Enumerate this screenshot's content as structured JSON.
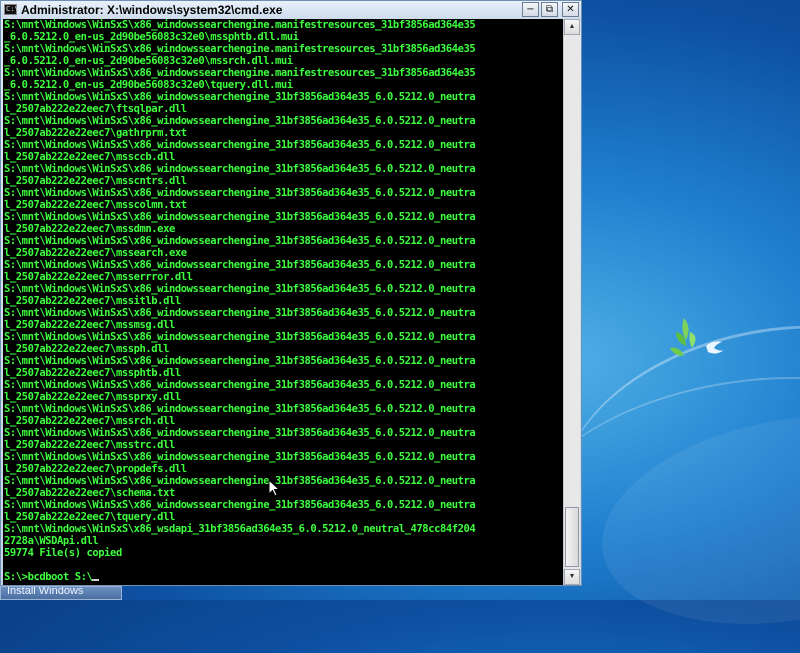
{
  "window": {
    "title": "Administrator: X:\\windows\\system32\\cmd.exe",
    "icon_label": "C:\\",
    "controls": {
      "minimize": "−",
      "maximize": "⧉",
      "close": "✕"
    }
  },
  "console": {
    "lines": [
      "S:\\mnt\\Windows\\WinSxS\\x86_windowssearchengine.manifestresources_31bf3856ad364e35",
      "_6.0.5212.0_en-us_2d90be56083c32e0\\mssphtb.dll.mui",
      "S:\\mnt\\Windows\\WinSxS\\x86_windowssearchengine.manifestresources_31bf3856ad364e35",
      "_6.0.5212.0_en-us_2d90be56083c32e0\\mssrch.dll.mui",
      "S:\\mnt\\Windows\\WinSxS\\x86_windowssearchengine.manifestresources_31bf3856ad364e35",
      "_6.0.5212.0_en-us_2d90be56083c32e0\\tquery.dll.mui",
      "S:\\mnt\\Windows\\WinSxS\\x86_windowssearchengine_31bf3856ad364e35_6.0.5212.0_neutra",
      "l_2507ab222e22eec7\\ftsqlpar.dll",
      "S:\\mnt\\Windows\\WinSxS\\x86_windowssearchengine_31bf3856ad364e35_6.0.5212.0_neutra",
      "l_2507ab222e22eec7\\gathrprm.txt",
      "S:\\mnt\\Windows\\WinSxS\\x86_windowssearchengine_31bf3856ad364e35_6.0.5212.0_neutra",
      "l_2507ab222e22eec7\\mssccb.dll",
      "S:\\mnt\\Windows\\WinSxS\\x86_windowssearchengine_31bf3856ad364e35_6.0.5212.0_neutra",
      "l_2507ab222e22eec7\\msscntrs.dll",
      "S:\\mnt\\Windows\\WinSxS\\x86_windowssearchengine_31bf3856ad364e35_6.0.5212.0_neutra",
      "l_2507ab222e22eec7\\msscolmn.txt",
      "S:\\mnt\\Windows\\WinSxS\\x86_windowssearchengine_31bf3856ad364e35_6.0.5212.0_neutra",
      "l_2507ab222e22eec7\\mssdmn.exe",
      "S:\\mnt\\Windows\\WinSxS\\x86_windowssearchengine_31bf3856ad364e35_6.0.5212.0_neutra",
      "l_2507ab222e22eec7\\mssearch.exe",
      "S:\\mnt\\Windows\\WinSxS\\x86_windowssearchengine_31bf3856ad364e35_6.0.5212.0_neutra",
      "l_2507ab222e22eec7\\msserrror.dll",
      "S:\\mnt\\Windows\\WinSxS\\x86_windowssearchengine_31bf3856ad364e35_6.0.5212.0_neutra",
      "l_2507ab222e22eec7\\mssitlb.dll",
      "S:\\mnt\\Windows\\WinSxS\\x86_windowssearchengine_31bf3856ad364e35_6.0.5212.0_neutra",
      "l_2507ab222e22eec7\\mssmsg.dll",
      "S:\\mnt\\Windows\\WinSxS\\x86_windowssearchengine_31bf3856ad364e35_6.0.5212.0_neutra",
      "l_2507ab222e22eec7\\mssph.dll",
      "S:\\mnt\\Windows\\WinSxS\\x86_windowssearchengine_31bf3856ad364e35_6.0.5212.0_neutra",
      "l_2507ab222e22eec7\\mssphtb.dll",
      "S:\\mnt\\Windows\\WinSxS\\x86_windowssearchengine_31bf3856ad364e35_6.0.5212.0_neutra",
      "l_2507ab222e22eec7\\mssprxy.dll",
      "S:\\mnt\\Windows\\WinSxS\\x86_windowssearchengine_31bf3856ad364e35_6.0.5212.0_neutra",
      "l_2507ab222e22eec7\\mssrch.dll",
      "S:\\mnt\\Windows\\WinSxS\\x86_windowssearchengine_31bf3856ad364e35_6.0.5212.0_neutra",
      "l_2507ab222e22eec7\\msstrc.dll",
      "S:\\mnt\\Windows\\WinSxS\\x86_windowssearchengine_31bf3856ad364e35_6.0.5212.0_neutra",
      "l_2507ab222e22eec7\\propdefs.dll",
      "S:\\mnt\\Windows\\WinSxS\\x86_windowssearchengine_31bf3856ad364e35_6.0.5212.0_neutra",
      "l_2507ab222e22eec7\\schema.txt",
      "S:\\mnt\\Windows\\WinSxS\\x86_windowssearchengine_31bf3856ad364e35_6.0.5212.0_neutra",
      "l_2507ab222e22eec7\\tquery.dll",
      "S:\\mnt\\Windows\\WinSxS\\x86_wsdapi_31bf3856ad364e35_6.0.5212.0_neutral_478cc84f204",
      "2728a\\WSDApi.dll",
      "59774 File(s) copied",
      ""
    ],
    "prompt": "S:\\>bcdboot S:\\"
  },
  "taskbar": {
    "item_label": "Install Windows"
  },
  "colors": {
    "console_text": "#3dff3d",
    "console_bg": "#000000",
    "desktop": "#1f7fcf"
  }
}
